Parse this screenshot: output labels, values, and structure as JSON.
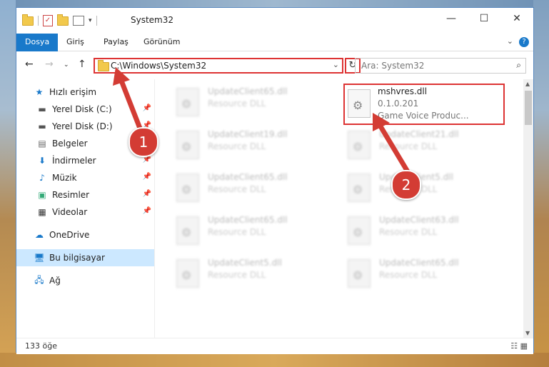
{
  "window": {
    "title": "System32",
    "controls": {
      "minimize": "—",
      "maximize": "☐",
      "close": "✕"
    }
  },
  "ribbon": {
    "tabs": [
      "Dosya",
      "Giriş",
      "Paylaş",
      "Görünüm"
    ],
    "help": "?"
  },
  "nav": {
    "address": "C:\\Windows\\System32",
    "search_placeholder": "Ara: System32"
  },
  "sidebar": {
    "items": [
      {
        "label": "Hızlı erişim",
        "icon": "star-icon"
      },
      {
        "label": "Yerel Disk (C:)",
        "icon": "drive-icon",
        "pinned": true
      },
      {
        "label": "Yerel Disk (D:)",
        "icon": "drive-icon",
        "pinned": true
      },
      {
        "label": "Belgeler",
        "icon": "documents-icon",
        "pinned": true
      },
      {
        "label": "İndirmeler",
        "icon": "download-icon",
        "pinned": true
      },
      {
        "label": "Müzik",
        "icon": "music-icon",
        "pinned": true
      },
      {
        "label": "Resimler",
        "icon": "pictures-icon",
        "pinned": true
      },
      {
        "label": "Videolar",
        "icon": "videos-icon",
        "pinned": true
      },
      {
        "label": "OneDrive",
        "icon": "cloud-icon"
      },
      {
        "label": "Bu bilgisayar",
        "icon": "computer-icon",
        "selected": true
      },
      {
        "label": "Ağ",
        "icon": "network-icon"
      }
    ]
  },
  "files": {
    "highlighted": {
      "name": "mshvres.dll",
      "version": "0.1.0.201",
      "description": "Game Voice    Produc..."
    },
    "blurred": [
      {
        "name": "UpdateClient65.dll",
        "type": "Resource DLL"
      },
      {
        "name": "UpdateClient19.dll",
        "type": "Resource DLL"
      },
      {
        "name": "UpdateClient21.dll",
        "type": "Resource DLL"
      },
      {
        "name": "UpdateClient65.dll",
        "type": "Resource DLL"
      },
      {
        "name": "UpdateClient5.dll",
        "type": "Resource DLL"
      },
      {
        "name": "UpdateClient65.dll",
        "type": "Resource DLL"
      },
      {
        "name": "UpdateClient63.dll",
        "type": "Resource DLL"
      },
      {
        "name": "UpdateClient5.dll",
        "type": "Resource DLL"
      },
      {
        "name": "UpdateClient65.dll",
        "type": "Resource DLL"
      }
    ]
  },
  "status": {
    "count": "133 öğe"
  },
  "annotations": {
    "badge1": "1",
    "badge2": "2",
    "color": "#d33c34"
  }
}
